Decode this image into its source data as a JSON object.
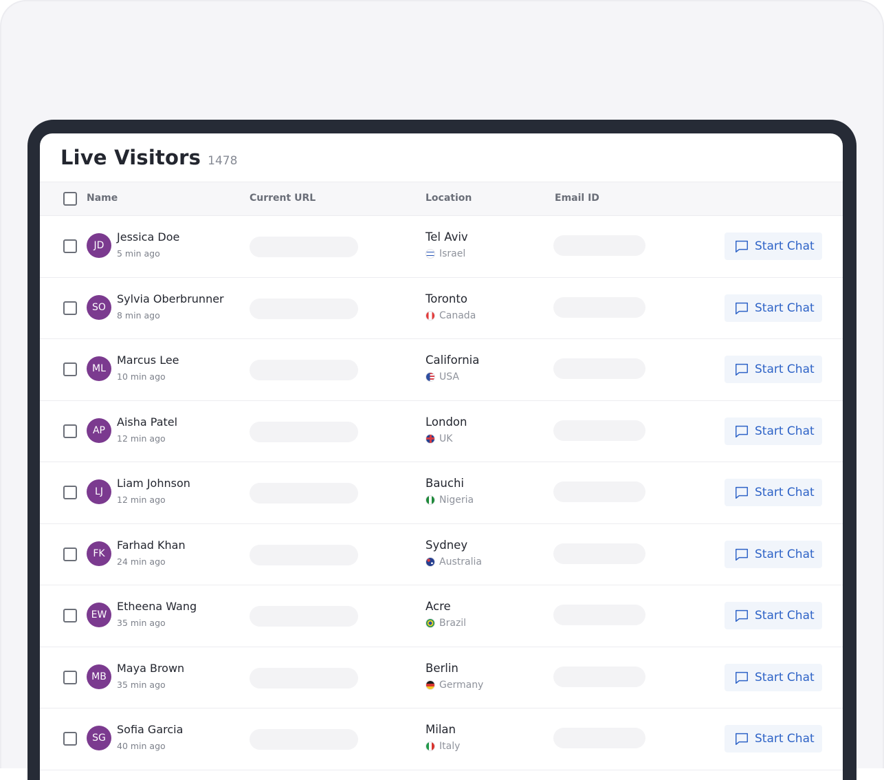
{
  "header": {
    "title": "Live Visitors",
    "count": "1478"
  },
  "columns": {
    "name": "Name",
    "url": "Current URL",
    "location": "Location",
    "email": "Email ID"
  },
  "action_label": "Start Chat",
  "colors": {
    "avatar": "#7b3a8f",
    "action": "#2e63c7",
    "frame": "#262b36"
  },
  "visitors": [
    {
      "initials": "JD",
      "name": "Jessica Doe",
      "time": "5 min ago",
      "city": "Tel Aviv",
      "country": "Israel",
      "flag": "israel-flag-icon"
    },
    {
      "initials": "SO",
      "name": "Sylvia Oberbrunner",
      "time": "8 min ago",
      "city": "Toronto",
      "country": "Canada",
      "flag": "canada-flag-icon"
    },
    {
      "initials": "ML",
      "name": "Marcus Lee",
      "time": "10 min ago",
      "city": "California",
      "country": "USA",
      "flag": "usa-flag-icon"
    },
    {
      "initials": "AP",
      "name": "Aisha Patel",
      "time": "12 min ago",
      "city": "London",
      "country": "UK",
      "flag": "uk-flag-icon"
    },
    {
      "initials": "LJ",
      "name": "Liam Johnson",
      "time": "12 min ago",
      "city": "Bauchi",
      "country": "Nigeria",
      "flag": "nigeria-flag-icon"
    },
    {
      "initials": "FK",
      "name": "Farhad Khan",
      "time": "24 min ago",
      "city": "Sydney",
      "country": "Australia",
      "flag": "australia-flag-icon"
    },
    {
      "initials": "EW",
      "name": "Etheena Wang",
      "time": "35 min ago",
      "city": "Acre",
      "country": "Brazil",
      "flag": "brazil-flag-icon"
    },
    {
      "initials": "MB",
      "name": "Maya Brown",
      "time": "35 min ago",
      "city": "Berlin",
      "country": "Germany",
      "flag": "germany-flag-icon"
    },
    {
      "initials": "SG",
      "name": "Sofia Garcia",
      "time": "40 min ago",
      "city": "Milan",
      "country": "Italy",
      "flag": "italy-flag-icon"
    }
  ]
}
